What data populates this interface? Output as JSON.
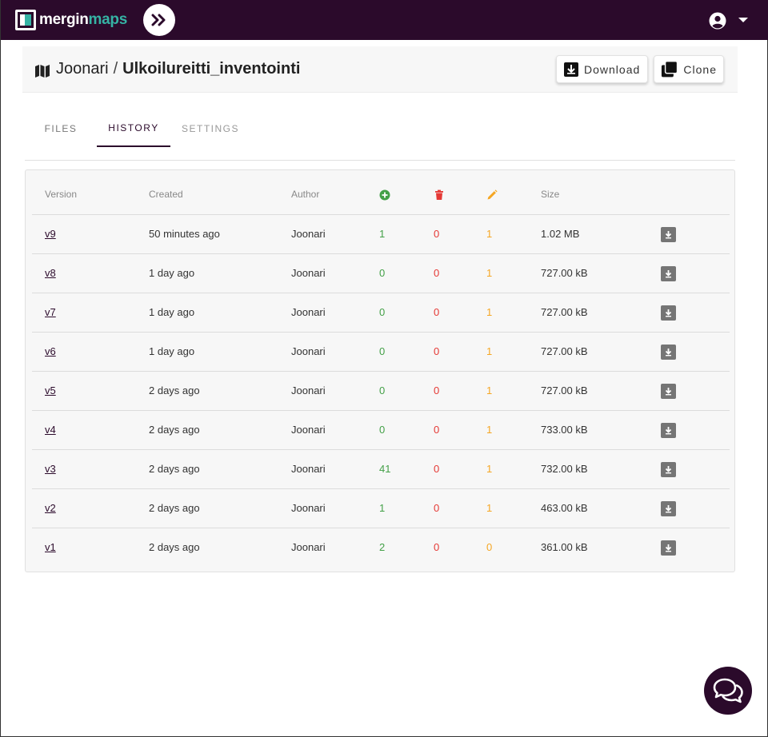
{
  "app": {
    "logo_part1": "mergin",
    "logo_part2": "maps",
    "brand_color": "#2b0a2b",
    "accent_color": "#35b3a4"
  },
  "header": {
    "namespace": "Joonari",
    "separator": "/",
    "project": "Ulkoilureitti_inventointi",
    "download_label": "Download",
    "clone_label": "Clone"
  },
  "tabs": [
    {
      "label": "FILES"
    },
    {
      "label": "HISTORY"
    },
    {
      "label": "SETTINGS"
    }
  ],
  "active_tab": "HISTORY",
  "table": {
    "columns": {
      "version": "Version",
      "created": "Created",
      "author": "Author",
      "added_icon": "plus-circle-icon",
      "deleted_icon": "trash-icon",
      "updated_icon": "pencil-icon",
      "size": "Size"
    },
    "rows": [
      {
        "version": "v9",
        "created": "50 minutes ago",
        "author": "Joonari",
        "added": "1",
        "deleted": "0",
        "updated": "1",
        "size": "1.02 MB"
      },
      {
        "version": "v8",
        "created": "1 day ago",
        "author": "Joonari",
        "added": "0",
        "deleted": "0",
        "updated": "1",
        "size": "727.00 kB"
      },
      {
        "version": "v7",
        "created": "1 day ago",
        "author": "Joonari",
        "added": "0",
        "deleted": "0",
        "updated": "1",
        "size": "727.00 kB"
      },
      {
        "version": "v6",
        "created": "1 day ago",
        "author": "Joonari",
        "added": "0",
        "deleted": "0",
        "updated": "1",
        "size": "727.00 kB"
      },
      {
        "version": "v5",
        "created": "2 days ago",
        "author": "Joonari",
        "added": "0",
        "deleted": "0",
        "updated": "1",
        "size": "727.00 kB"
      },
      {
        "version": "v4",
        "created": "2 days ago",
        "author": "Joonari",
        "added": "0",
        "deleted": "0",
        "updated": "1",
        "size": "733.00 kB"
      },
      {
        "version": "v3",
        "created": "2 days ago",
        "author": "Joonari",
        "added": "41",
        "deleted": "0",
        "updated": "1",
        "size": "732.00 kB"
      },
      {
        "version": "v2",
        "created": "2 days ago",
        "author": "Joonari",
        "added": "1",
        "deleted": "0",
        "updated": "1",
        "size": "463.00 kB"
      },
      {
        "version": "v1",
        "created": "2 days ago",
        "author": "Joonari",
        "added": "2",
        "deleted": "0",
        "updated": "0",
        "size": "361.00 kB"
      }
    ]
  },
  "status_colors": {
    "added": "#43a047",
    "deleted": "#e53935",
    "updated": "#f5a623"
  }
}
